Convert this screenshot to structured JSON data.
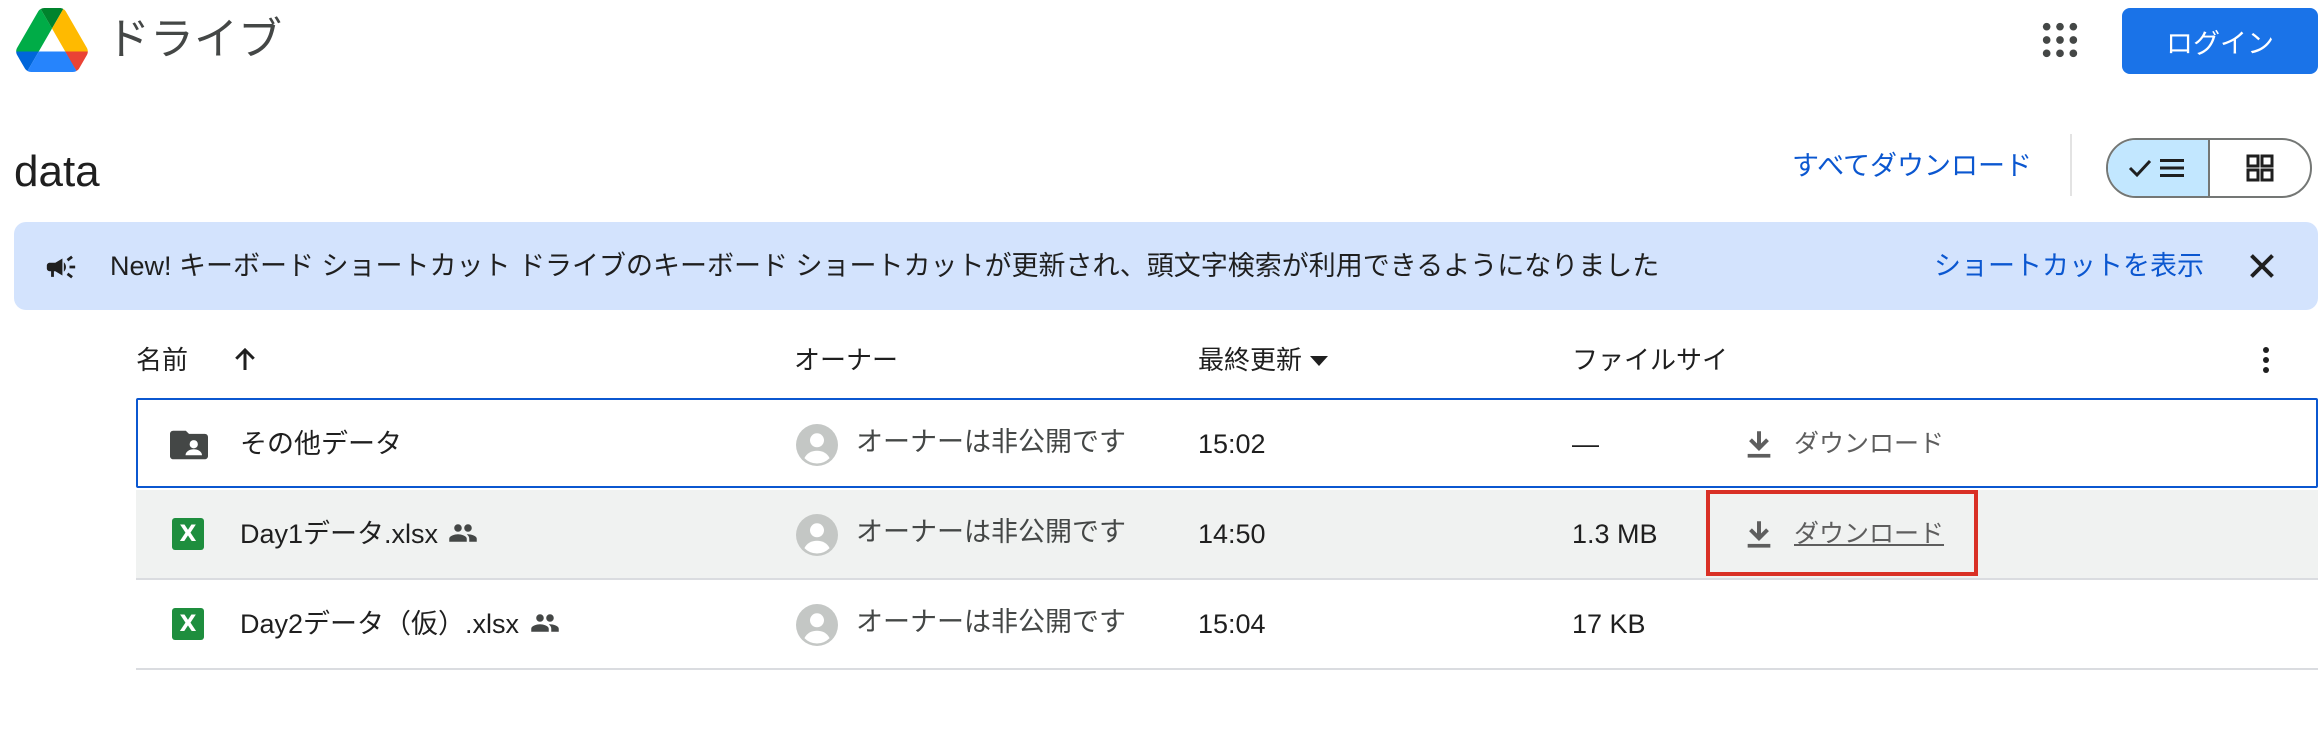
{
  "header": {
    "brand": "ドライブ",
    "login_label": "ログイン",
    "icons": [
      "google-drive-logo",
      "apps-grid-icon"
    ]
  },
  "page": {
    "title": "data",
    "download_all": "すべてダウンロード",
    "view_mode": "list"
  },
  "banner": {
    "new_label": "New!",
    "message": " キーボード ショートカット ドライブのキーボード ショートカットが更新され、頭文字検索が利用できるようになりました",
    "link_label": "ショートカットを表示"
  },
  "table": {
    "columns": {
      "name": "名前",
      "owner": "オーナー",
      "modified": "最終更新",
      "size": "ファイルサイ"
    },
    "rows": [
      {
        "name": "その他データ",
        "type": "folder",
        "shared": false,
        "owner": "オーナーは非公開です",
        "modified": "15:02",
        "size": "—",
        "download": "ダウンロード"
      },
      {
        "name": "Day1データ.xlsx",
        "type": "xlsx",
        "shared": true,
        "owner": "オーナーは非公開です",
        "modified": "14:50",
        "size": "1.3 MB",
        "download": "ダウンロード"
      },
      {
        "name": "Day2データ（仮）.xlsx",
        "type": "xlsx",
        "shared": true,
        "owner": "オーナーは非公開です",
        "modified": "15:04",
        "size": "17 KB"
      }
    ]
  },
  "colors": {
    "primary": "#1a73e8",
    "link": "#0b57d0",
    "banner_bg": "#d3e3fd",
    "toggle_active": "#c2e7ff",
    "excel_green": "#1e8e3e",
    "highlight_red": "#d93025"
  }
}
